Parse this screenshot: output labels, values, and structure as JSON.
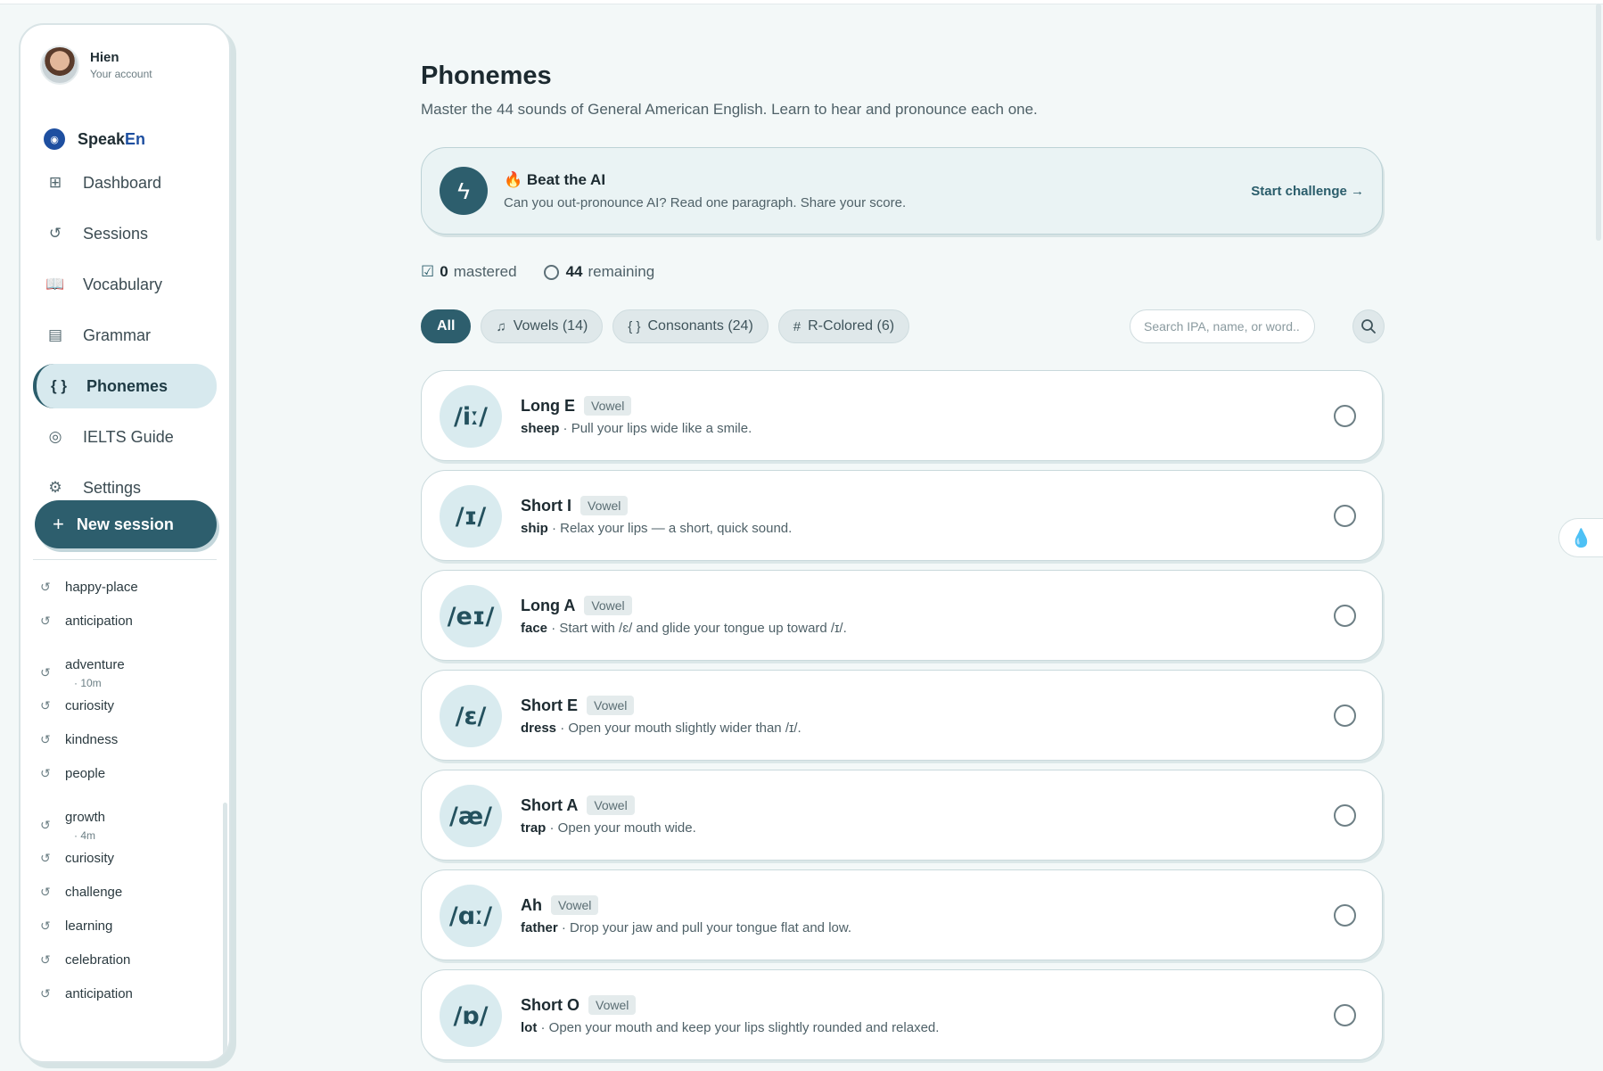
{
  "user": {
    "name": "Hien",
    "subtitle": "Your account"
  },
  "brand": {
    "part1": "Speak",
    "part2": "En",
    "logo_icon": "sound-wave-icon"
  },
  "nav": [
    {
      "label": "Dashboard",
      "icon": "grid-icon",
      "glyph": "⊞"
    },
    {
      "label": "Sessions",
      "icon": "history-icon",
      "glyph": "↺"
    },
    {
      "label": "Vocabulary",
      "icon": "book-open-icon",
      "glyph": "📖"
    },
    {
      "label": "Grammar",
      "icon": "notebook-icon",
      "glyph": "▤"
    },
    {
      "label": "Phonemes",
      "icon": "braces-icon",
      "glyph": "{ }",
      "active": true
    },
    {
      "label": "IELTS Guide",
      "icon": "target-icon",
      "glyph": "◎"
    },
    {
      "label": "Settings",
      "icon": "gear-icon",
      "glyph": "⚙"
    }
  ],
  "new_session_label": "New session",
  "history": [
    {
      "label": "happy-place"
    },
    {
      "label": "anticipation"
    },
    {
      "label": "adventure",
      "sub": "· 10m"
    },
    {
      "label": "curiosity"
    },
    {
      "label": "kindness"
    },
    {
      "label": "people"
    },
    {
      "label": "growth",
      "sub": "· 4m"
    },
    {
      "label": "curiosity"
    },
    {
      "label": "challenge"
    },
    {
      "label": "learning"
    },
    {
      "label": "celebration"
    },
    {
      "label": "anticipation"
    }
  ],
  "page": {
    "title": "Phonemes",
    "subtitle": "Master the 44 sounds of General American English. Learn to hear and pronounce each one."
  },
  "challenge": {
    "title": "🔥 Beat the AI",
    "description": "Can you out-pronounce AI? Read one paragraph. Share your score.",
    "link": "Start challenge →"
  },
  "stats": {
    "mastered_count": "0",
    "mastered_label": "mastered",
    "remaining_count": "44",
    "remaining_label": "remaining"
  },
  "filters": [
    {
      "label": "All",
      "active": true
    },
    {
      "label": "Vowels (14)",
      "icon": "music-note-icon",
      "glyph": "♫"
    },
    {
      "label": "Consonants (24)",
      "icon": "braces-icon",
      "glyph": "{ }"
    },
    {
      "label": "R-Colored (6)",
      "icon": "hash-icon",
      "glyph": "#"
    }
  ],
  "search": {
    "placeholder": "Search IPA, name, or word..."
  },
  "phonemes": [
    {
      "ipa": "/iː/",
      "name": "Long E",
      "type": "Vowel",
      "word": "sheep",
      "tip": " · Pull your lips wide like a smile."
    },
    {
      "ipa": "/ɪ/",
      "name": "Short I",
      "type": "Vowel",
      "word": "ship",
      "tip": " · Relax your lips — a short, quick sound."
    },
    {
      "ipa": "/eɪ/",
      "name": "Long A",
      "type": "Vowel",
      "word": "face",
      "tip": " · Start with /ɛ/ and glide your tongue up toward /ɪ/."
    },
    {
      "ipa": "/ɛ/",
      "name": "Short E",
      "type": "Vowel",
      "word": "dress",
      "tip": " · Open your mouth slightly wider than /ɪ/."
    },
    {
      "ipa": "/æ/",
      "name": "Short A",
      "type": "Vowel",
      "word": "trap",
      "tip": " · Open your mouth wide."
    },
    {
      "ipa": "/ɑː/",
      "name": "Ah",
      "type": "Vowel",
      "word": "father",
      "tip": " · Drop your jaw and pull your tongue flat and low."
    },
    {
      "ipa": "/ɒ/",
      "name": "Short O",
      "type": "Vowel",
      "word": "lot",
      "tip": " · Open your mouth and keep your lips slightly rounded and relaxed."
    }
  ],
  "colors": {
    "accent": "#2d5e6d",
    "brand": "#1e4fa0",
    "background": "#f3f8f8"
  }
}
